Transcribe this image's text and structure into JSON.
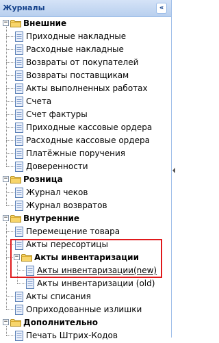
{
  "panel": {
    "title": "Журналы",
    "collapse_glyph": "«"
  },
  "tree": {
    "groups": [
      {
        "label": "Внешние",
        "expanded": true,
        "items": [
          {
            "label": "Приходные накладные"
          },
          {
            "label": "Расходные накладные"
          },
          {
            "label": "Возвраты от покупателей"
          },
          {
            "label": "Возвраты поставщикам"
          },
          {
            "label": "Акты выполненных работах"
          },
          {
            "label": "Счета"
          },
          {
            "label": "Счет фактуры"
          },
          {
            "label": "Приходные кассовые ордера"
          },
          {
            "label": "Расходные кассовые ордера"
          },
          {
            "label": "Платёжные поручения"
          },
          {
            "label": "Доверенности"
          }
        ]
      },
      {
        "label": "Розница",
        "expanded": true,
        "items": [
          {
            "label": "Журнал чеков"
          },
          {
            "label": "Журнал возвратов"
          }
        ]
      },
      {
        "label": "Внутренние",
        "expanded": true,
        "items": [
          {
            "label": "Перемещение товара"
          },
          {
            "label": "Акты пересортицы"
          },
          {
            "label": "Акты инвентаризации",
            "expanded": true,
            "highlighted": true,
            "items": [
              {
                "label": "Акты инвентаризации(new)",
                "underlined": true
              },
              {
                "label": "Акты инвентаризации (old)"
              }
            ]
          },
          {
            "label": "Акты списания"
          },
          {
            "label": "Оприходованные излишки"
          }
        ]
      },
      {
        "label": "Дополнительно",
        "expanded": true,
        "items": [
          {
            "label": "Печать Штрих-Кодов"
          }
        ]
      }
    ]
  },
  "colors": {
    "header_text": "#15428b",
    "highlight_border": "#e0191b",
    "folder_fill": "#f7d56b",
    "doc_fill": "#eaf0fb"
  },
  "icons": {
    "folder": "folder-icon",
    "document": "document-icon",
    "toggle": "minus-toggle-icon"
  }
}
